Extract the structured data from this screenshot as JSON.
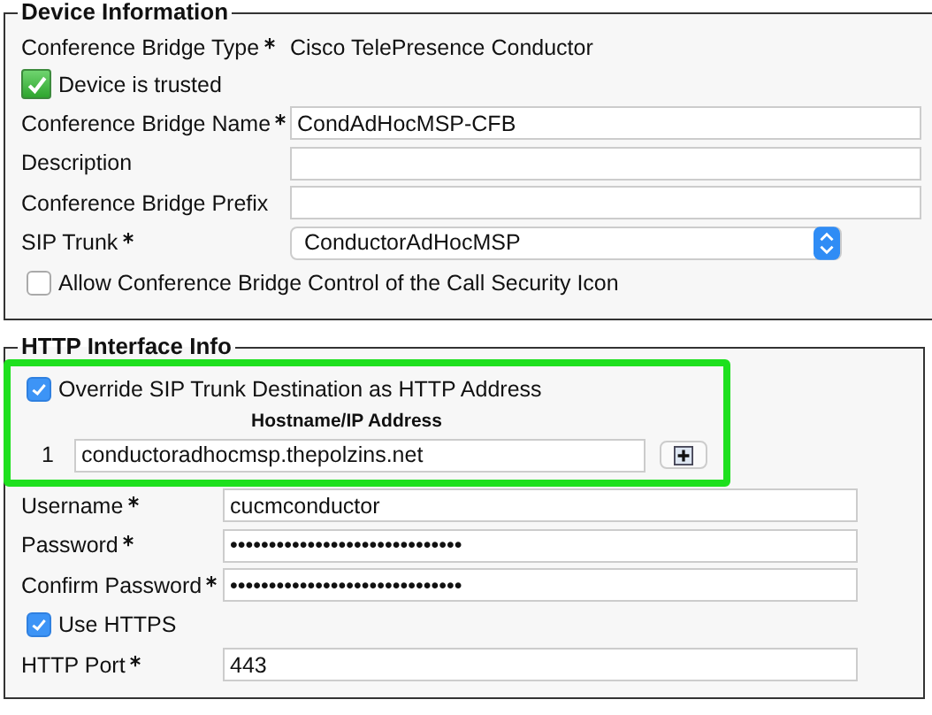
{
  "device_information": {
    "legend": "Device Information",
    "bridge_type": {
      "label": "Conference Bridge Type",
      "required": true,
      "value": "Cisco TelePresence Conductor"
    },
    "trusted": {
      "label": "Device is trusted",
      "checked": true
    },
    "fields": [
      {
        "kind": "text",
        "label": "Conference Bridge Name",
        "required": true,
        "value": "CondAdHocMSP-CFB"
      },
      {
        "kind": "text",
        "label": "Description",
        "required": false
      },
      {
        "kind": "text",
        "label": "Conference Bridge Prefix",
        "required": false
      },
      {
        "kind": "select",
        "label": "SIP Trunk",
        "required": true,
        "value": "ConductorAdHocMSP"
      }
    ],
    "allow_control": {
      "label": "Allow Conference Bridge Control of the Call Security Icon",
      "checked": false
    }
  },
  "http_interface": {
    "legend": "HTTP Interface Info",
    "override": {
      "label": "Override SIP Trunk Destination as HTTP Address",
      "checked": true
    },
    "hosts": {
      "heading": "Hostname/IP Address",
      "rows": [
        {
          "index": "1",
          "value": "conductoradhocmsp.thepolzins.net"
        }
      ]
    },
    "rows": [
      {
        "kind": "text",
        "label": "Username",
        "required": true,
        "value": "cucmconductor"
      },
      {
        "kind": "text",
        "label": "Password",
        "required": true,
        "value": "••••••••••••••••••••••••••••••"
      },
      {
        "kind": "text",
        "label": "Confirm Password",
        "required": true,
        "value": "••••••••••••••••••••••••••••••"
      },
      {
        "kind": "checkbox",
        "label": "Use HTTPS",
        "checked": true
      },
      {
        "kind": "text",
        "label": "HTTP Port",
        "required": true,
        "value": "443"
      }
    ]
  }
}
